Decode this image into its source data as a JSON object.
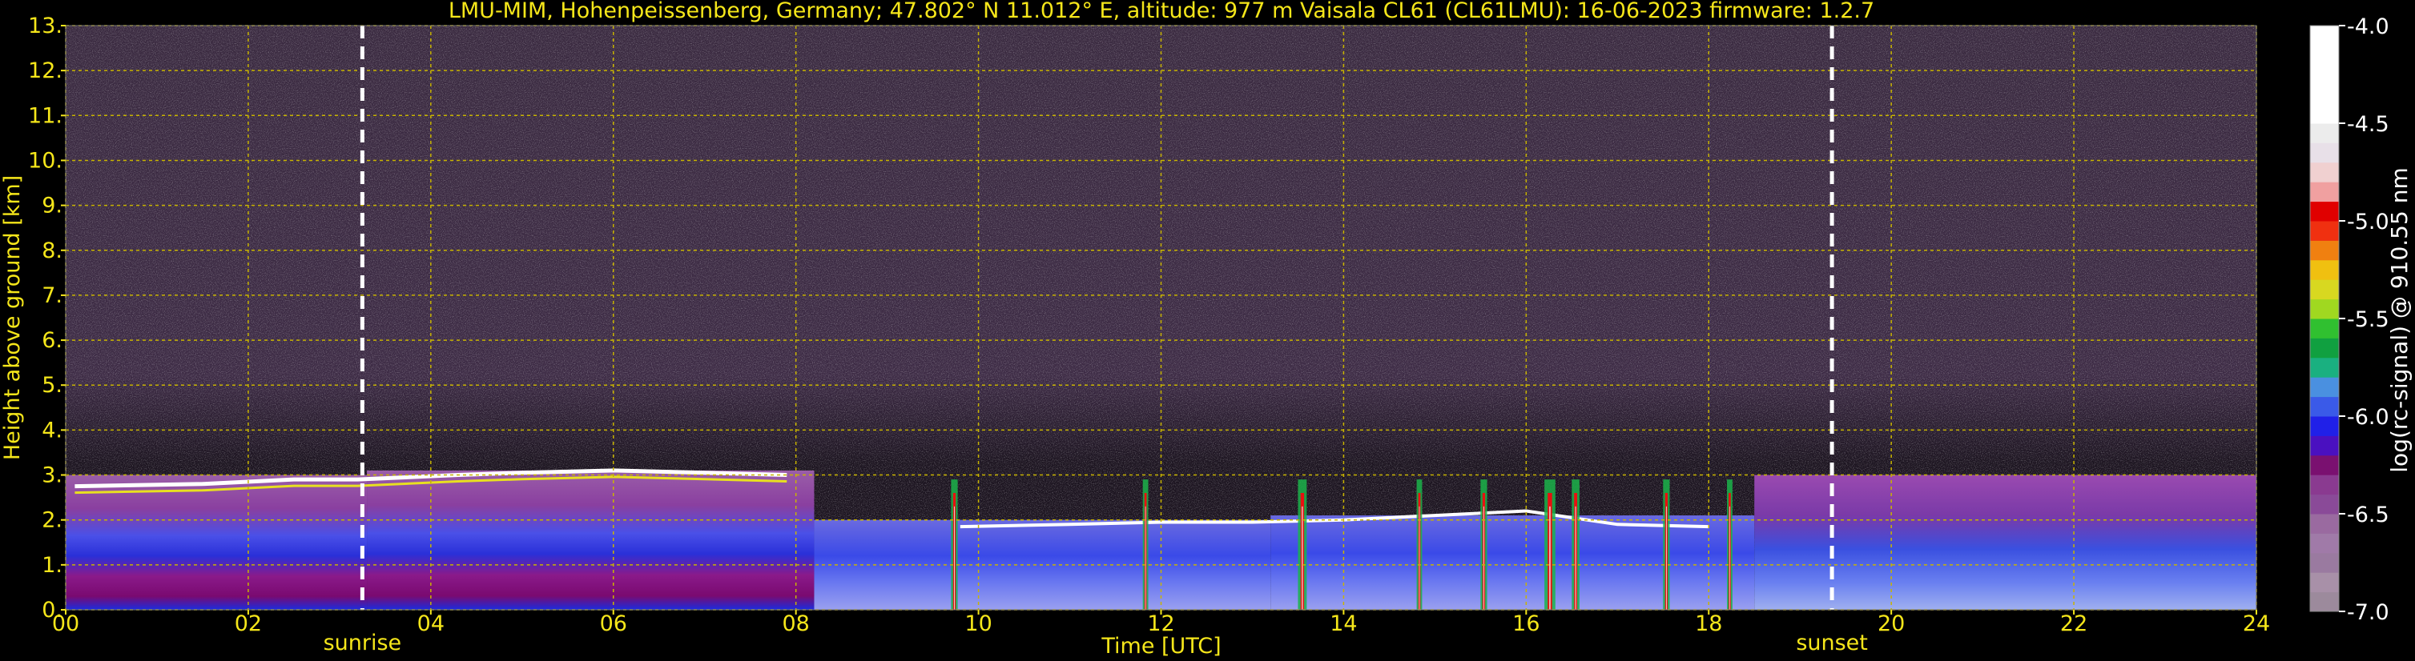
{
  "chart_data": {
    "type": "heatmap",
    "title": "LMU-MIM, Hohenpeissenberg, Germany; 47.802° N 11.012° E, altitude: 977 m    Vaisala CL61 (CL61LMU): 16-06-2023    firmware: 1.2.7",
    "xlabel": "Time [UTC]",
    "ylabel": "Height above ground [km]",
    "x_range_hours": [
      0,
      24
    ],
    "y_range_km": [
      0,
      13
    ],
    "x_ticks": [
      "00",
      "02",
      "04",
      "06",
      "08",
      "10",
      "12",
      "14",
      "16",
      "18",
      "20",
      "22",
      "24"
    ],
    "y_ticks": [
      "0.",
      "1.",
      "2.",
      "3.",
      "4.",
      "5.",
      "6.",
      "7.",
      "8.",
      "9.",
      "10.",
      "11.",
      "12.",
      "13."
    ],
    "grid": true,
    "annotations": [
      {
        "label": "sunrise",
        "time_hours": 3.25
      },
      {
        "label": "sunset",
        "time_hours": 19.35
      }
    ],
    "colorbar": {
      "label": "log(rc-signal) @ 910.55 nm",
      "range": [
        -7.0,
        -4.0
      ],
      "ticks": [
        "-4.0",
        "-4.5",
        "-5.0",
        "-5.5",
        "-6.0",
        "-6.5",
        "-7.0"
      ],
      "tick_values": [
        -4.0,
        -4.5,
        -5.0,
        -5.5,
        -6.0,
        -6.5,
        -7.0
      ]
    },
    "colors": {
      "text": "#f5e61a",
      "grid": "#c8b400",
      "background": "#000000"
    }
  }
}
